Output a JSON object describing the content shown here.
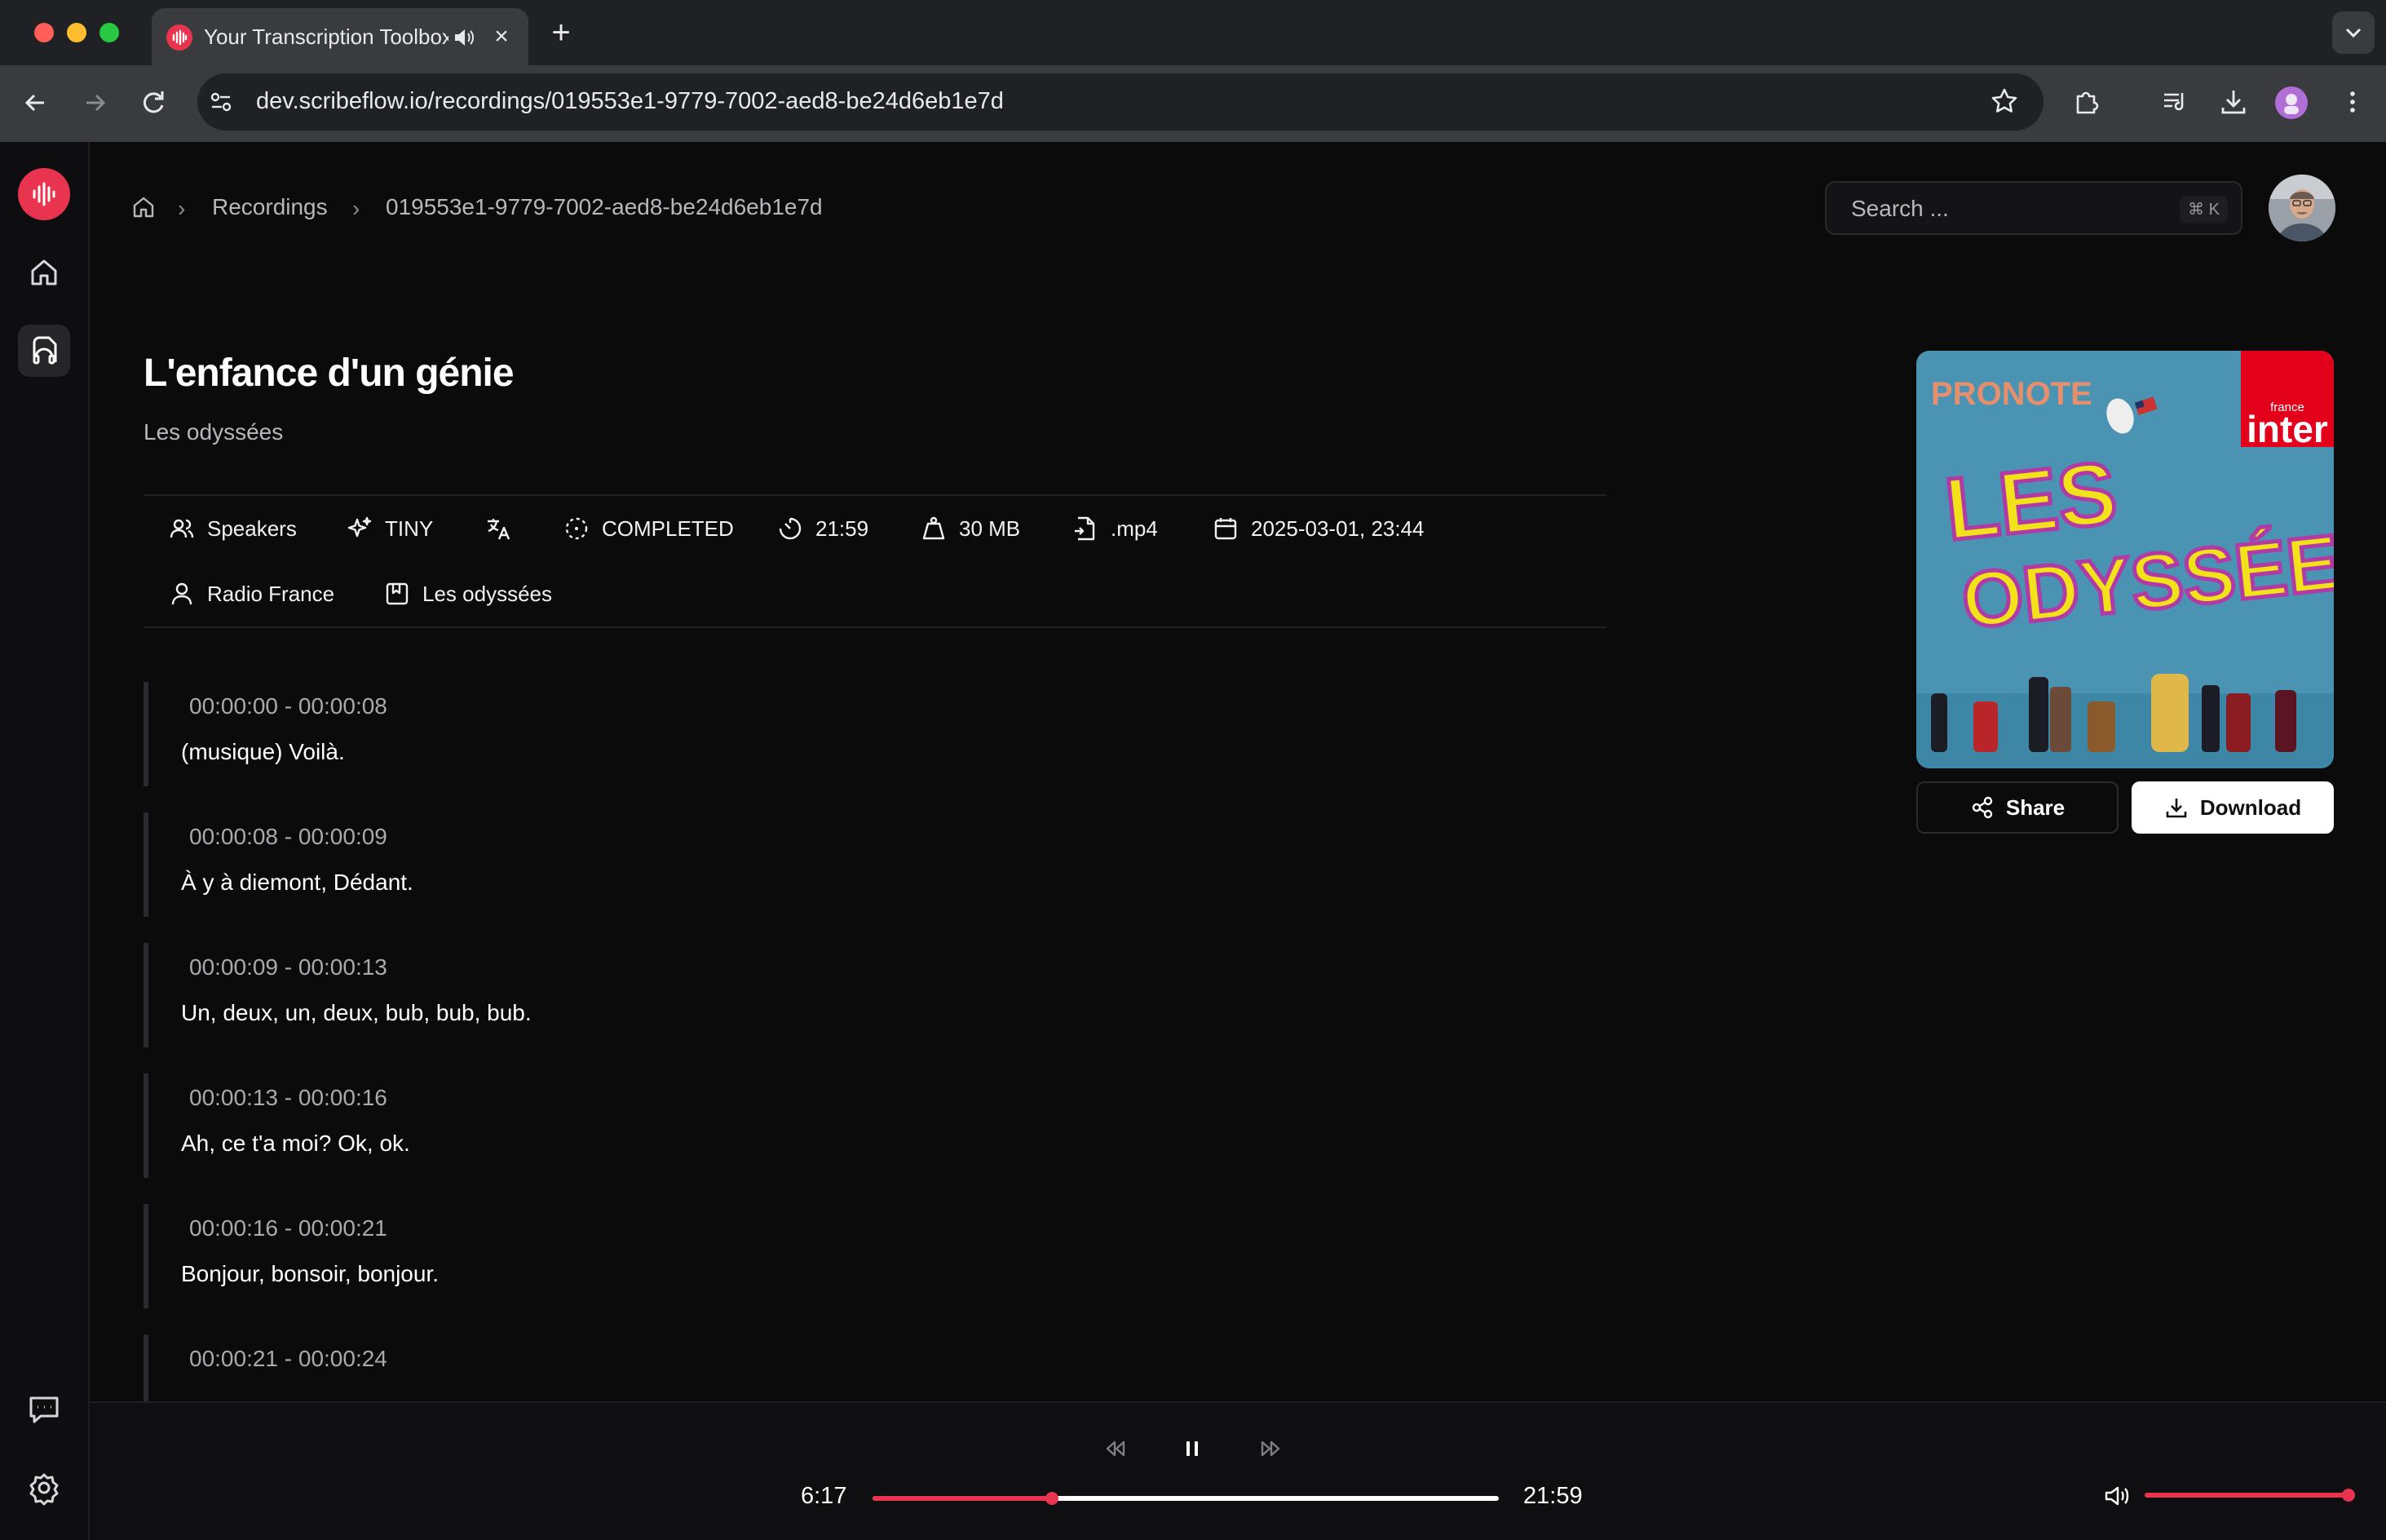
{
  "browser": {
    "tab_title": "Your Transcription Toolbox",
    "url": "dev.scribeflow.io/recordings/019553e1-9779-7002-aed8-be24d6eb1e7d"
  },
  "breadcrumb": {
    "section": "Recordings",
    "current": "019553e1-9779-7002-aed8-be24d6eb1e7d"
  },
  "search": {
    "placeholder": "Search ...",
    "shortcut": "⌘ K"
  },
  "recording": {
    "title": "L'enfance d'un génie",
    "subtitle": "Les odyssées",
    "meta": {
      "speakers": "Speakers",
      "model": "TINY",
      "status": "COMPLETED",
      "duration": "21:59",
      "size": "30 MB",
      "format": ".mp4",
      "date": "2025-03-01, 23:44",
      "publisher": "Radio France",
      "collection": "Les odyssées"
    }
  },
  "segments": [
    {
      "time": "00:00:00 - 00:00:08",
      "text": "(musique) Voilà."
    },
    {
      "time": "00:00:08 - 00:00:09",
      "text": "À y à diemont, Dédant."
    },
    {
      "time": "00:00:09 - 00:00:13",
      "text": "Un, deux, un, deux, bub, bub, bub."
    },
    {
      "time": "00:00:13 - 00:00:16",
      "text": "Ah, ce t'a moi? Ok, ok."
    },
    {
      "time": "00:00:16 - 00:00:21",
      "text": "Bonjour, bonsoir, bonjour."
    },
    {
      "time": "00:00:21 - 00:00:24",
      "text": ""
    }
  ],
  "cover": {
    "brand_top": "PRONOTE",
    "station_small": "france",
    "station": "inter",
    "show_line1": "LES",
    "show_line2": "ODYSSÉES"
  },
  "actions": {
    "share": "Share",
    "download": "Download"
  },
  "player": {
    "current_time": "6:17",
    "total_time": "21:59",
    "progress": 0.286,
    "volume": 1.0
  },
  "colors": {
    "accent": "#e8344e",
    "background": "#0b0b0c"
  },
  "icons": {
    "sidebar": [
      "waveform-logo-icon",
      "home-icon",
      "recordings-icon",
      "chat-icon",
      "settings-icon"
    ]
  }
}
